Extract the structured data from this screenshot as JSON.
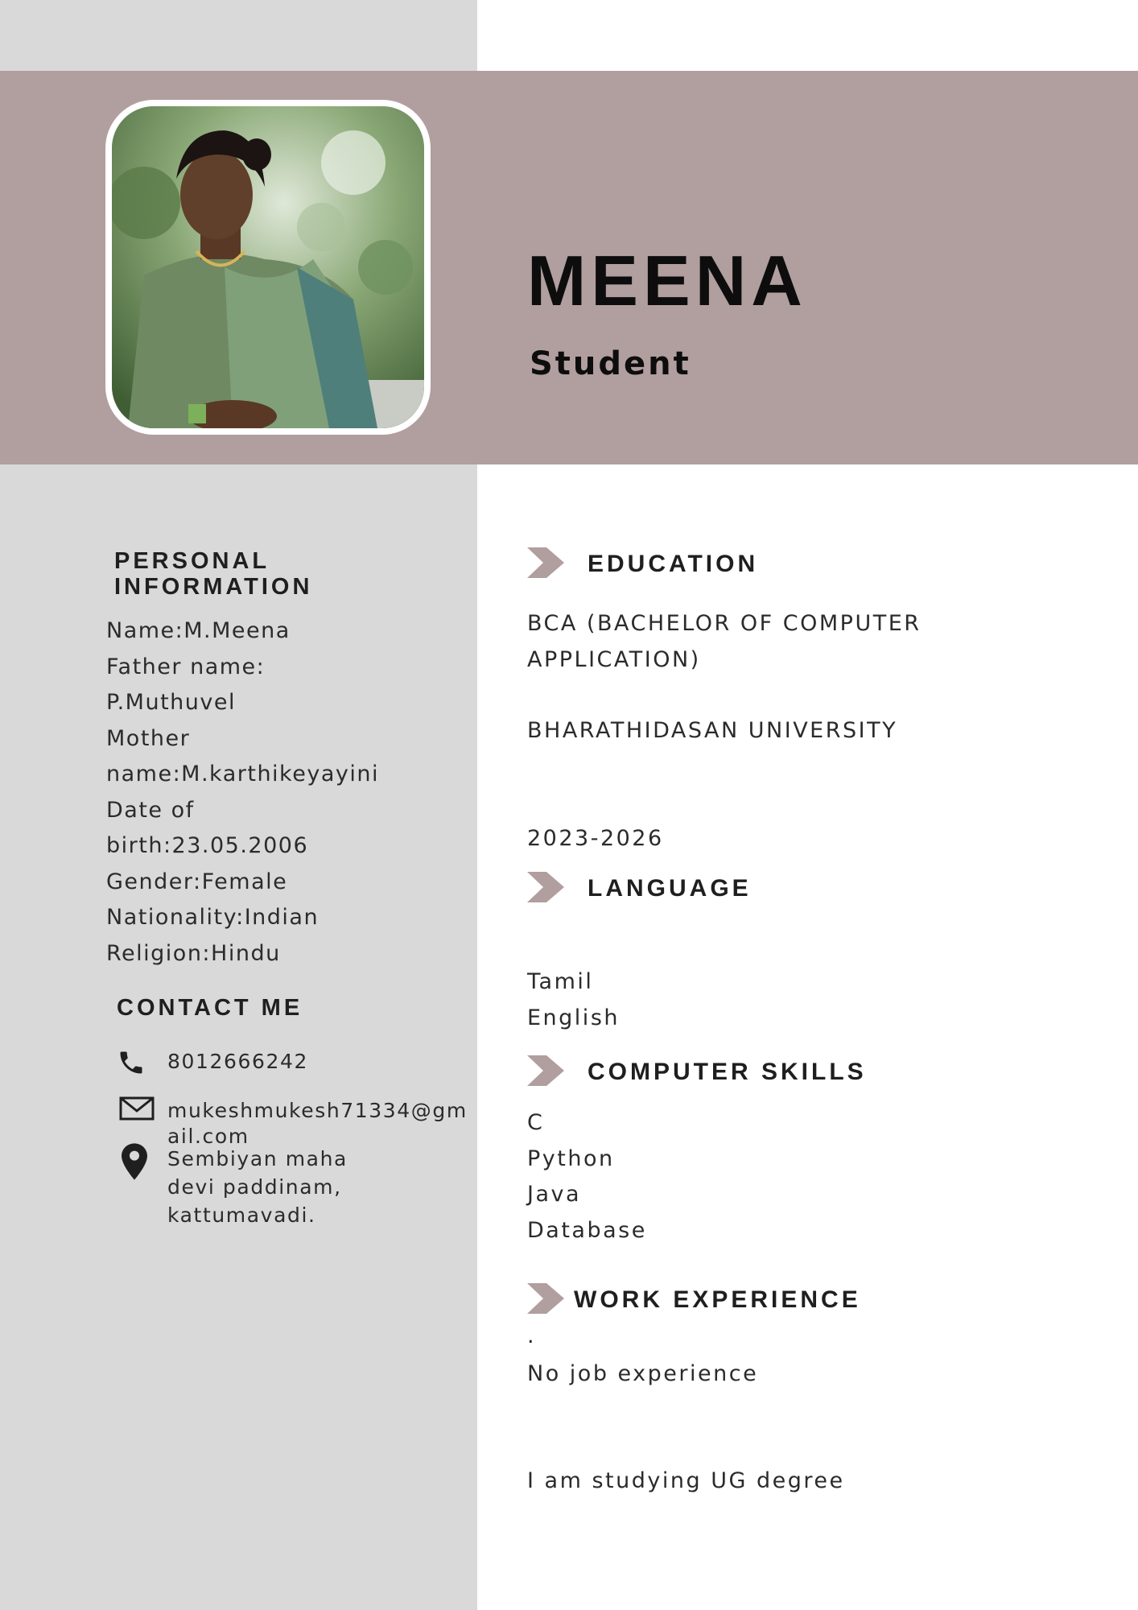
{
  "header": {
    "name": "MEENA",
    "role": "Student"
  },
  "personal": {
    "title_line1": "PERSONAL",
    "title_line2": "INFORMATION",
    "lines": [
      "Name:M.Meena",
      "Father name:",
      "P.Muthuvel",
      "Mother",
      "name:M.karthikeyayini",
      "Date of",
      "birth:23.05.2006",
      "Gender:Female",
      "Nationality:Indian",
      "Religion:Hindu"
    ]
  },
  "contact": {
    "title": "CONTACT ME",
    "phone": "8012666242",
    "email_line1": "mukeshmukesh71334@gm",
    "email_line2": "ail.com",
    "address_line1": "Sembiyan maha",
    "address_line2": "devi paddinam,",
    "address_line3": "kattumavadi."
  },
  "education": {
    "title": "EDUCATION",
    "degree_line1": "BCA (BACHELOR OF COMPUTER",
    "degree_line2": "APPLICATION)",
    "university": "BHARATHIDASAN UNIVERSITY",
    "years": "2023-2026"
  },
  "language": {
    "title": "LANGUAGE",
    "items": [
      "Tamil",
      "English"
    ]
  },
  "skills": {
    "title": "COMPUTER SKILLS",
    "items": [
      "C",
      "Python",
      "Java",
      "Database"
    ]
  },
  "work": {
    "title": "WORK EXPERIENCE",
    "dot": ".",
    "line1": "No job experience",
    "line2": "I am studying  UG degree"
  },
  "colors": {
    "banner": "#b19e9f",
    "left_column": "#d9d9d9",
    "arrow": "#b19e9f"
  },
  "icons": {
    "phone": "phone-icon",
    "email": "envelope-icon",
    "address": "map-pin-icon",
    "section": "chevron-arrow-icon"
  }
}
